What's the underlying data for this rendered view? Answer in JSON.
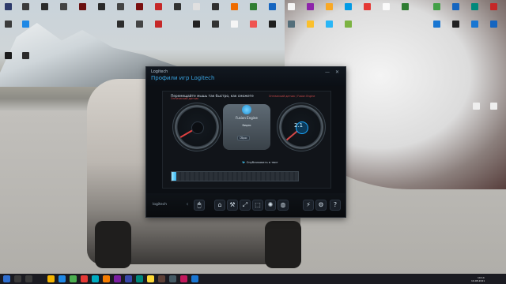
{
  "desktop": {
    "top_row_icons": [
      {
        "label": "",
        "color": "#1a73e8"
      },
      {
        "label": "",
        "color": "#3d3d3d"
      },
      {
        "label": "",
        "color": "#4a4a4a"
      },
      {
        "label": "",
        "color": "#e53935"
      }
    ]
  },
  "logitech": {
    "brand": "Logitech",
    "title": "Профили игр Logitech",
    "controls": {
      "minimize": "—",
      "close": "✕"
    },
    "header": "Перемещайте мышь так быстро, как сможете",
    "left_gauge_label": "Оптический датчик",
    "right_gauge_label": "Оптический датчик / Fusion Engine",
    "center": {
      "engine": "Fusion Engine",
      "mode": "Видео",
      "button": "Сброс"
    },
    "right_value": "2.1",
    "twitter_text": "Опубликовать в твит",
    "progress": 0.04,
    "footer_brand": "logitech"
  },
  "taskbar": {
    "time": "19:14",
    "date": "19.08.2021"
  }
}
